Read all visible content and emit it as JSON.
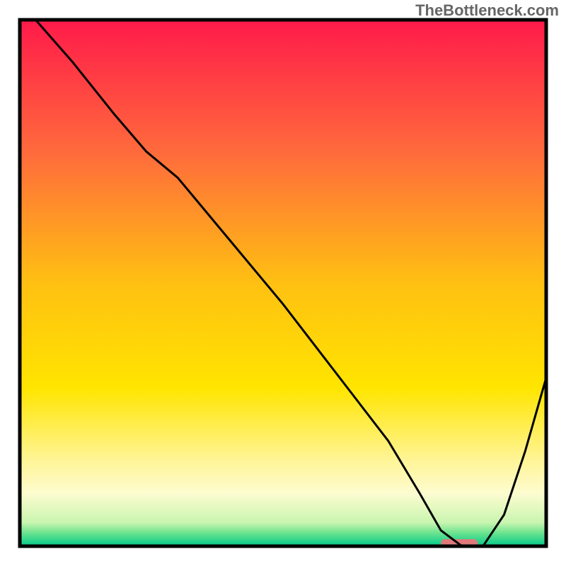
{
  "watermark": "TheBottleneck.com",
  "chart_data": {
    "type": "line",
    "title": "",
    "xlabel": "",
    "ylabel": "",
    "xlim": [
      0,
      100
    ],
    "ylim": [
      0,
      100
    ],
    "grid": false,
    "legend": false,
    "gradient_bands": [
      {
        "stop": 0.0,
        "color": "#ff1a4a"
      },
      {
        "stop": 0.25,
        "color": "#ff6a3c"
      },
      {
        "stop": 0.5,
        "color": "#ffc012"
      },
      {
        "stop": 0.7,
        "color": "#ffe500"
      },
      {
        "stop": 0.84,
        "color": "#fff59a"
      },
      {
        "stop": 0.9,
        "color": "#fdfcd0"
      },
      {
        "stop": 0.955,
        "color": "#c9f5b0"
      },
      {
        "stop": 0.975,
        "color": "#6ae38f"
      },
      {
        "stop": 1.0,
        "color": "#00c98a"
      }
    ],
    "series": [
      {
        "name": "bottleneck-curve",
        "color": "#000000",
        "x": [
          3,
          10,
          18,
          24,
          30,
          40,
          50,
          60,
          70,
          76,
          80,
          84,
          88,
          92,
          96,
          100
        ],
        "y": [
          100,
          92,
          82,
          75,
          70,
          58,
          46,
          33,
          20,
          10,
          3,
          0,
          0,
          6,
          18,
          32
        ]
      }
    ],
    "marker": {
      "name": "optimal-region",
      "color": "#de7a7a",
      "x_start": 80,
      "x_end": 87,
      "y": 0.6,
      "height": 1.5
    },
    "frame": {
      "color": "#000000",
      "width": 5
    }
  }
}
